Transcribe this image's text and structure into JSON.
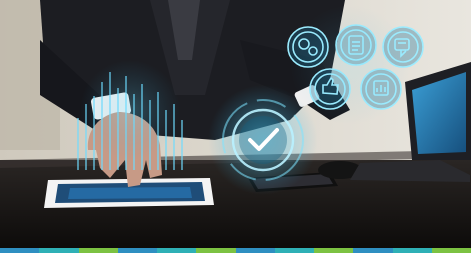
{
  "image": {
    "subject": "person-using-tablet-with-holographic-icons",
    "overlay_icons": [
      "gears-icon",
      "clipboard-checklist-icon",
      "document-chat-icon",
      "thumbs-up-icon",
      "report-chart-icon",
      "checkmark-circle-icon"
    ]
  },
  "brand_stripe": {
    "colors": [
      "#2f8fc1",
      "#2fb0b6",
      "#7cc242",
      "#2f8fc1",
      "#2fb0b6",
      "#7cc242",
      "#2f8fc1",
      "#2fb0b6",
      "#7cc242",
      "#2f8fc1",
      "#2fb0b6",
      "#7cc242"
    ]
  }
}
